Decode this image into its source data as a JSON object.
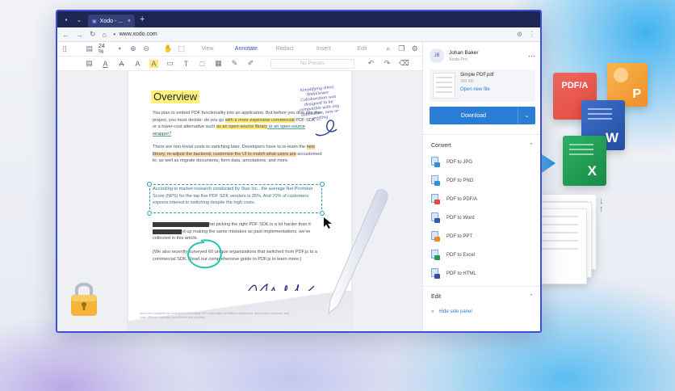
{
  "browser": {
    "tab_title": "Xodo - ...",
    "url": "www.xodo.com"
  },
  "toolbar": {
    "zoom": "24 %",
    "modes": [
      "View",
      "Annotate",
      "Redact",
      "Insert",
      "Edit"
    ],
    "active_mode": "Annotate",
    "presets": "No Presets"
  },
  "document": {
    "heading": "Overview",
    "p1": {
      "a": "You plan to embed PDF functionality into an application. But before you dive into the project, you must decide: do you go ",
      "h1": "with a more expensive commercial",
      "b": " PDF SDK — or a lower-cost alternative such ",
      "h2": "as an open-source library",
      "c": " or an open-source wrapper?"
    },
    "p2": {
      "a": "There are non-trivial costs to switching later. Developers have to re-learn the ",
      "h1": "new library, re-adjust the backend, customize the UI to match what users are",
      "b": " accustomed to, as well as migrate documents, form data, annotations, and more."
    },
    "p3": "According to market research conducted by Stax Inc., the average Net Promoter Score (NPS) for the top five PDF SDK vendors is 35%. And 70% of customers express interest in switching despite the high costs.",
    "p4": "This dissatisfaction implies that picking the right PDF SDK is a lot harder than it looks. Many end up making the same mistakes as past implementations, we've collected in this article.",
    "p5": "(We also recently surveyed 60 unique organizations that switched from PDF.js to a commercial SDK. Read our comprehensive guide to PDF.js to learn more.)",
    "handwritten_note": "Simplifying since, WebViewer Collaboration was designed to be compatible with any application, new or existing",
    "footer": "Above are companies we reviewed for embedding PDF functionality into different applications. Beyond their outcomes, their costs, different challenges and different best practices."
  },
  "side_panel": {
    "user_name": "Johan Baker",
    "user_plan": "Xodo Pro",
    "initials": "JB",
    "file_name": "Simple PDF.pdf",
    "file_size": "300 KB",
    "open_new": "Open new file",
    "download": "Download",
    "convert_title": "Convert",
    "convert_items": [
      {
        "label": "PDF to JPG",
        "color": "#2f8fd8"
      },
      {
        "label": "PDF to PNG",
        "color": "#2f8fd8"
      },
      {
        "label": "PDF to PDF/A",
        "color": "#e5483f"
      },
      {
        "label": "PDF to Word",
        "color": "#2f5fb3"
      },
      {
        "label": "PDF to PPT",
        "color": "#f0852a"
      },
      {
        "label": "PDF to Excel",
        "color": "#1e9a55"
      },
      {
        "label": "PDF to HTML",
        "color": "#3a4da0"
      }
    ],
    "edit_title": "Edit",
    "hide_panel": "Hide side panel"
  },
  "floating_icons": {
    "pdfa": "PDF/A",
    "ppt": "P",
    "word": "W",
    "excel": "X"
  },
  "colors": {
    "pdfa": "#e9514a",
    "ppt": "#f4a43c",
    "word": "#2b58b3",
    "excel": "#1f9b53",
    "accent": "#2a7ed6"
  }
}
